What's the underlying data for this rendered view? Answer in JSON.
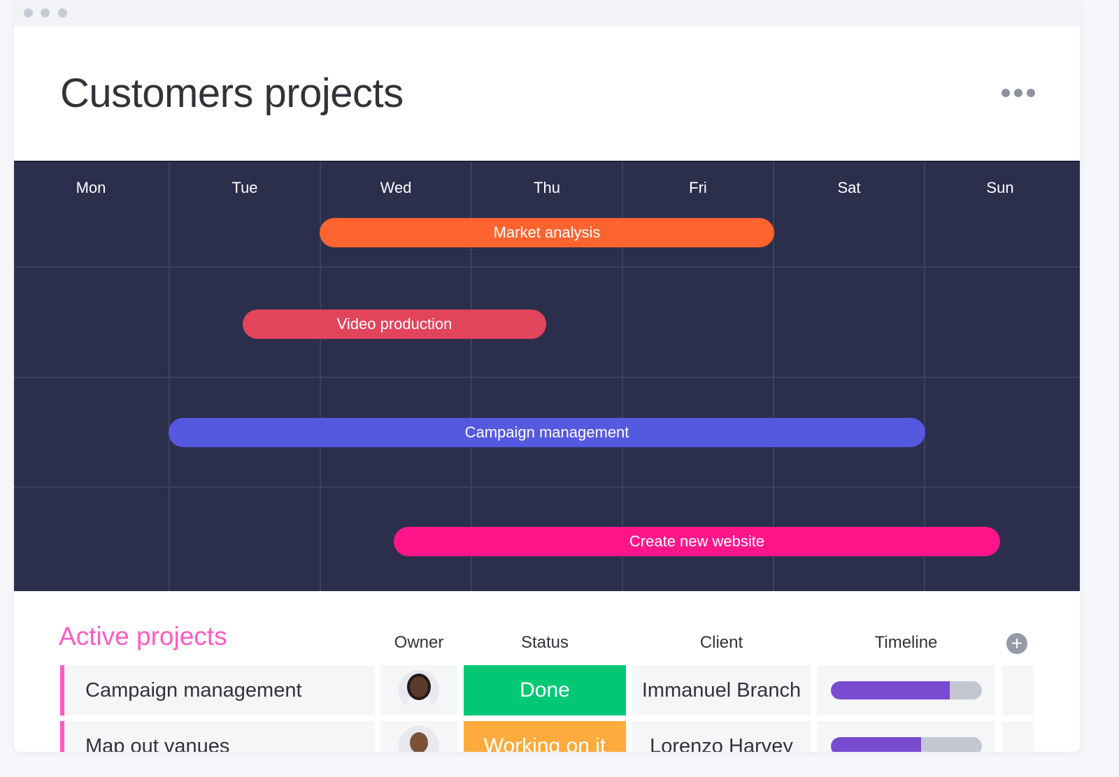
{
  "page": {
    "title": "Customers projects"
  },
  "calendar": {
    "days": [
      "Mon",
      "Tue",
      "Wed",
      "Thu",
      "Fri",
      "Sat",
      "Sun"
    ],
    "bars": [
      {
        "label": "Market analysis",
        "color": "#ff642e",
        "start_day": "Wed",
        "end_day": "Fri"
      },
      {
        "label": "Video production",
        "color": "#e2445c",
        "start_day": "Tue",
        "end_day": "Thu"
      },
      {
        "label": "Campaign management",
        "color": "#5559df",
        "start_day": "Tue",
        "end_day": "Sat"
      },
      {
        "label": "Create new website",
        "color": "#ff158a",
        "start_day": "Wed",
        "end_day": "Sun"
      }
    ]
  },
  "table": {
    "group_title": "Active projects",
    "group_color": "#ff5ac4",
    "columns": {
      "owner": "Owner",
      "status": "Status",
      "client": "Client",
      "timeline": "Timeline"
    },
    "rows": [
      {
        "name": "Campaign management",
        "owner_avatar": "woman-avatar",
        "status": "Done",
        "status_color": "#00c875",
        "client": "Immanuel Branch",
        "timeline_progress": 0.79
      },
      {
        "name": "Map out vanues",
        "owner_avatar": "man-avatar",
        "status": "Working on it",
        "status_color": "#fdab3d",
        "client": "Lorenzo Harvey",
        "timeline_progress": 0.6
      }
    ]
  },
  "colors": {
    "calendar_bg": "#2b2f4c",
    "timeline_fill": "#784bd1"
  }
}
